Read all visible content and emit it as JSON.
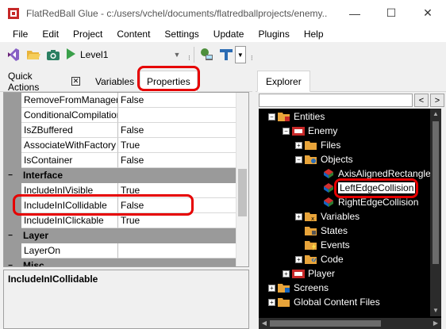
{
  "window": {
    "title": "FlatRedBall Glue - c:/users/vchel/documents/flatredballprojects/enemy...",
    "minimize": "—",
    "maximize": "☐",
    "close": "✕"
  },
  "menu": [
    "File",
    "Edit",
    "Project",
    "Content",
    "Settings",
    "Update",
    "Plugins",
    "Help"
  ],
  "toolbar": {
    "level": "Level1"
  },
  "left_tabs": {
    "quick_actions": "Quick Actions",
    "quick_actions_close": "✕",
    "variables": "Variables",
    "properties": "Properties"
  },
  "property_grid": {
    "rows": [
      {
        "name": "RemoveFromManagers",
        "value": "False"
      },
      {
        "name": "ConditionalCompilation",
        "value": ""
      },
      {
        "name": "IsZBuffered",
        "value": "False"
      },
      {
        "name": "AssociateWithFactory",
        "value": "True"
      },
      {
        "name": "IsContainer",
        "value": "False"
      }
    ],
    "category_interface": "Interface",
    "interface_rows": [
      {
        "name": "IncludeInIVisible",
        "value": "True"
      },
      {
        "name": "IncludeInICollidable",
        "value": "False"
      },
      {
        "name": "IncludeInIClickable",
        "value": "True"
      }
    ],
    "category_layer": "Layer",
    "layer_rows": [
      {
        "name": "LayerOn",
        "value": ""
      }
    ],
    "category_misc": "Misc",
    "toggle_collapse": "−"
  },
  "description": "IncludeInICollidable",
  "explorer": {
    "tab": "Explorer",
    "back": "<",
    "forward": ">",
    "tree": [
      {
        "label": "Entities",
        "level": 0,
        "expander": "−"
      },
      {
        "label": "Enemy",
        "level": 1,
        "expander": "−"
      },
      {
        "label": "Files",
        "level": 2,
        "expander": "+"
      },
      {
        "label": "Objects",
        "level": 2,
        "expander": "−"
      },
      {
        "label": "AxisAlignedRectangle",
        "level": 3,
        "expander": ""
      },
      {
        "label": "LeftEdgeCollision",
        "level": 3,
        "expander": ""
      },
      {
        "label": "RightEdgeCollision",
        "level": 3,
        "expander": ""
      },
      {
        "label": "Variables",
        "level": 2,
        "expander": "+"
      },
      {
        "label": "States",
        "level": 2,
        "expander": ""
      },
      {
        "label": "Events",
        "level": 2,
        "expander": ""
      },
      {
        "label": "Code",
        "level": 2,
        "expander": "+"
      },
      {
        "label": "Player",
        "level": 1,
        "expander": "+"
      },
      {
        "label": "Screens",
        "level": 0,
        "expander": "+"
      },
      {
        "label": "Global Content Files",
        "level": 0,
        "expander": "+"
      }
    ]
  },
  "colors": {
    "highlight": "#e60000",
    "tree_bg": "#000000",
    "category_bg": "#9a9a9a"
  }
}
